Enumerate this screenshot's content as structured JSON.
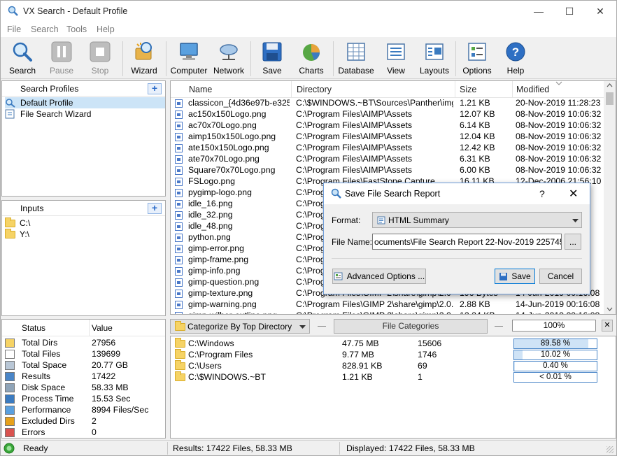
{
  "window": {
    "title": "VX Search - Default Profile",
    "minimize": "—",
    "maximize": "☐",
    "close": "✕"
  },
  "menu": [
    "File",
    "Search",
    "Tools",
    "Help"
  ],
  "toolbar": {
    "search": "Search",
    "pause": "Pause",
    "stop": "Stop",
    "wizard": "Wizard",
    "computer": "Computer",
    "network": "Network",
    "save": "Save",
    "charts": "Charts",
    "database": "Database",
    "view": "View",
    "layouts": "Layouts",
    "options": "Options",
    "help": "Help"
  },
  "profiles": {
    "header": "Search Profiles",
    "items": [
      "Default Profile",
      "File Search Wizard"
    ]
  },
  "inputs": {
    "header": "Inputs",
    "items": [
      "C:\\",
      "Y:\\"
    ]
  },
  "columns": {
    "name": "Name",
    "directory": "Directory",
    "size": "Size",
    "modified": "Modified"
  },
  "files": [
    {
      "name": "classicon_{4d36e97b-e325...",
      "dir": "C:\\$WINDOWS.~BT\\Sources\\Panther\\img",
      "size": "1.21 KB",
      "modified": "20-Nov-2019 11:28:23"
    },
    {
      "name": "ac150x150Logo.png",
      "dir": "C:\\Program Files\\AIMP\\Assets",
      "size": "12.07 KB",
      "modified": "08-Nov-2019 10:06:32"
    },
    {
      "name": "ac70x70Logo.png",
      "dir": "C:\\Program Files\\AIMP\\Assets",
      "size": "6.14 KB",
      "modified": "08-Nov-2019 10:06:32"
    },
    {
      "name": "aimp150x150Logo.png",
      "dir": "C:\\Program Files\\AIMP\\Assets",
      "size": "12.04 KB",
      "modified": "08-Nov-2019 10:06:32"
    },
    {
      "name": "ate150x150Logo.png",
      "dir": "C:\\Program Files\\AIMP\\Assets",
      "size": "12.42 KB",
      "modified": "08-Nov-2019 10:06:32"
    },
    {
      "name": "ate70x70Logo.png",
      "dir": "C:\\Program Files\\AIMP\\Assets",
      "size": "6.31 KB",
      "modified": "08-Nov-2019 10:06:32"
    },
    {
      "name": "Square70x70Logo.png",
      "dir": "C:\\Program Files\\AIMP\\Assets",
      "size": "6.00 KB",
      "modified": "08-Nov-2019 10:06:32"
    },
    {
      "name": "FSLogo.png",
      "dir": "C:\\Program Files\\FastStone Capture",
      "size": "16.11 KB",
      "modified": "12-Dec-2006 21:56:10"
    },
    {
      "name": "pygimp-logo.png",
      "dir": "C:\\Prog",
      "size": "",
      "modified": ""
    },
    {
      "name": "idle_16.png",
      "dir": "C:\\Prog",
      "size": "",
      "modified": "2"
    },
    {
      "name": "idle_32.png",
      "dir": "C:\\Prog",
      "size": "",
      "modified": "2"
    },
    {
      "name": "idle_48.png",
      "dir": "C:\\Prog",
      "size": "",
      "modified": "2"
    },
    {
      "name": "python.png",
      "dir": "C:\\Prog",
      "size": "",
      "modified": "2"
    },
    {
      "name": "gimp-error.png",
      "dir": "C:\\Prog",
      "size": "",
      "modified": ""
    },
    {
      "name": "gimp-frame.png",
      "dir": "C:\\Prog",
      "size": "",
      "modified": ""
    },
    {
      "name": "gimp-info.png",
      "dir": "C:\\Prog",
      "size": "",
      "modified": ""
    },
    {
      "name": "gimp-question.png",
      "dir": "C:\\Prog",
      "size": "",
      "modified": ""
    },
    {
      "name": "gimp-texture.png",
      "dir": "C:\\Program Files\\GIMP 2\\share\\gimp\\2.0",
      "size": "196 Bytes",
      "modified": "14-Jun-2019 00:16:08"
    },
    {
      "name": "gimp-warning.png",
      "dir": "C:\\Program Files\\GIMP 2\\share\\gimp\\2.0...",
      "size": "2.88 KB",
      "modified": "14-Jun-2019 00:16:08"
    },
    {
      "name": "gimp-wilber-outline.png",
      "dir": "C:\\Program Files\\GIMP 2\\share\\gimp\\2.0...",
      "size": "12.24 KB",
      "modified": "14-Jun-2019 00:16:08"
    }
  ],
  "status": {
    "col_status": "Status",
    "col_value": "Value",
    "rows": [
      {
        "name": "Total Dirs",
        "value": "27956",
        "icon": "folder-icon"
      },
      {
        "name": "Total Files",
        "value": "139699",
        "icon": "file-icon"
      },
      {
        "name": "Total Space",
        "value": "20.77 GB",
        "icon": "disk-icon"
      },
      {
        "name": "Results",
        "value": "17422",
        "icon": "results-icon"
      },
      {
        "name": "Disk Space",
        "value": "58.33 MB",
        "icon": "disk-space-icon"
      },
      {
        "name": "Process Time",
        "value": "15.53 Sec",
        "icon": "clock-icon"
      },
      {
        "name": "Performance",
        "value": "8994 Files/Sec",
        "icon": "gauge-icon"
      },
      {
        "name": "Excluded Dirs",
        "value": "2",
        "icon": "lock-icon"
      },
      {
        "name": "Errors",
        "value": "0",
        "icon": "error-icon"
      }
    ]
  },
  "categories": {
    "dropdown": "Categorize By Top Directory",
    "file_categories": "File Categories",
    "total_pct": "100%",
    "rows": [
      {
        "dir": "C:\\Windows",
        "size": "47.75 MB",
        "count": "15606",
        "pct_label": "89.58 %",
        "pct": 89.58
      },
      {
        "dir": "C:\\Program Files",
        "size": "9.77 MB",
        "count": "1746",
        "pct_label": "10.02 %",
        "pct": 10.02
      },
      {
        "dir": "C:\\Users",
        "size": "828.91 KB",
        "count": "69",
        "pct_label": "0.40 %",
        "pct": 0.4
      },
      {
        "dir": "C:\\$WINDOWS.~BT",
        "size": "1.21 KB",
        "count": "1",
        "pct_label": "< 0.01 %",
        "pct": 0.01
      }
    ]
  },
  "statusbar": {
    "ready": "Ready",
    "results": "Results: 17422 Files, 58.33 MB",
    "displayed": "Displayed: 17422 Files, 58.33 MB"
  },
  "dialog": {
    "title": "Save File Search Report",
    "help": "?",
    "close": "✕",
    "format_label": "Format:",
    "format_value": "HTML Summary",
    "filename_label": "File Name:",
    "filename_value": "ocuments\\File Search Report 22-Nov-2019 225745.html",
    "browse": "...",
    "advanced": "Advanced Options ...",
    "save": "Save",
    "cancel": "Cancel"
  }
}
